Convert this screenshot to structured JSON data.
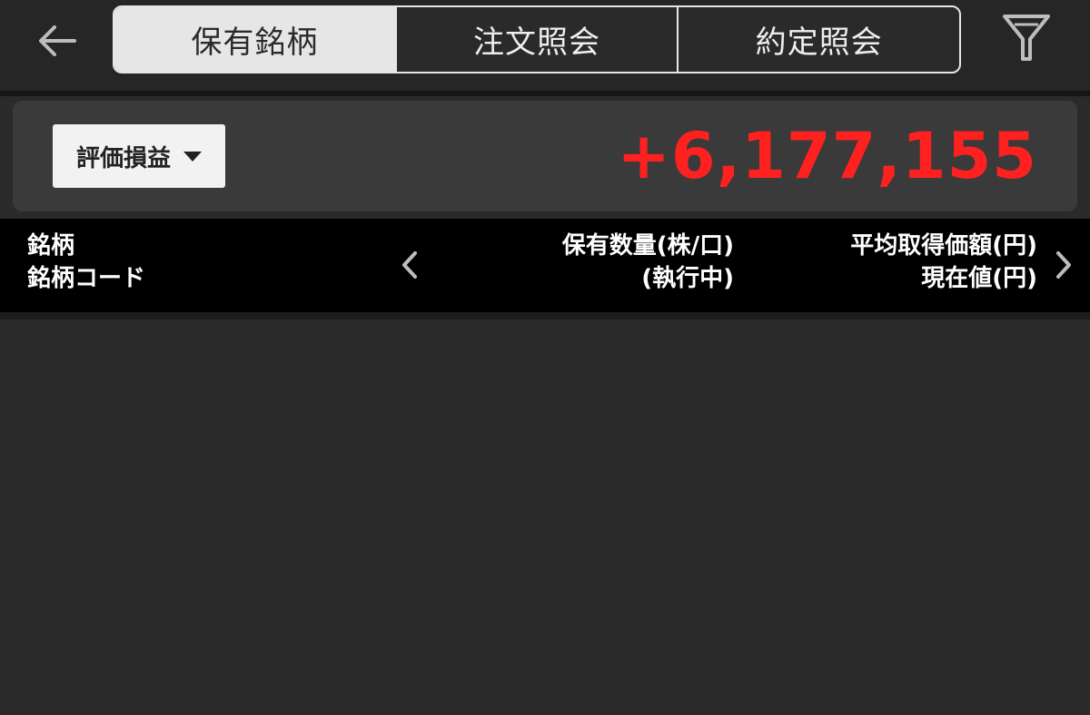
{
  "topbar": {
    "back_icon": "back-arrow-icon",
    "filter_icon": "filter-funnel-icon",
    "tabs": [
      {
        "label": "保有銘柄",
        "active": true
      },
      {
        "label": "注文照会",
        "active": false
      },
      {
        "label": "約定照会",
        "active": false
      }
    ]
  },
  "summary": {
    "metric_label": "評価損益",
    "value": "+6,177,155",
    "value_color": "#ff2020"
  },
  "columns": {
    "name_line1": "銘柄",
    "name_line2": "銘柄コード",
    "qty_line1": "保有数量(株/口)",
    "qty_line2": "(執行中)",
    "price_line1": "平均取得価額(円)",
    "price_line2": "現在値(円)"
  },
  "colors": {
    "background": "#2a2a2a",
    "header_background": "#000000",
    "active_tab": "#e6e6e6",
    "profit": "#ff2020"
  }
}
